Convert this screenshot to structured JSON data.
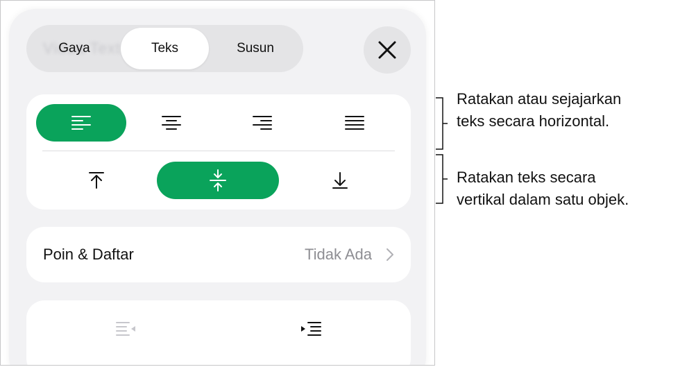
{
  "tabs": [
    {
      "label": "Gaya",
      "active": false
    },
    {
      "label": "Teks",
      "active": true
    },
    {
      "label": "Susun",
      "active": false
    }
  ],
  "accent_color": "#0aa35b",
  "horizontal_alignment": {
    "options": [
      "align-left-icon",
      "align-center-icon",
      "align-right-icon",
      "justify-icon"
    ],
    "selected": "align-left-icon"
  },
  "vertical_alignment": {
    "options": [
      "align-top-icon",
      "align-middle-icon",
      "align-bottom-icon"
    ],
    "selected": "align-middle-icon"
  },
  "bullets_row": {
    "label": "Poin & Daftar",
    "value": "Tidak Ada"
  },
  "indent": {
    "decrease_enabled": false,
    "increase_enabled": true
  },
  "annotations": {
    "horizontal": [
      "Ratakan atau sejajarkan",
      "teks secara horizontal."
    ],
    "vertical": [
      "Ratakan teks secara",
      "vertikal dalam satu objek."
    ]
  }
}
